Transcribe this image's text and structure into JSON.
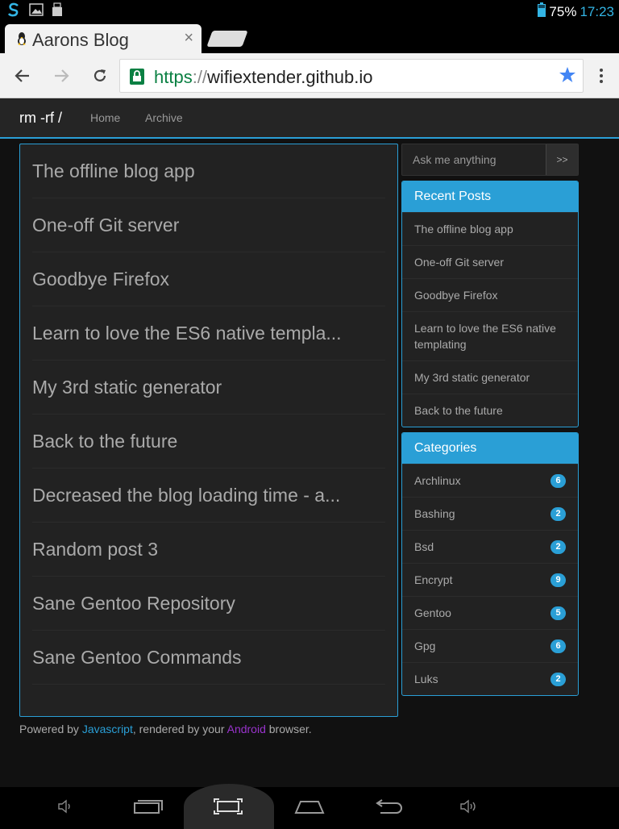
{
  "status": {
    "battery": "75%",
    "time": "17:23"
  },
  "tab": {
    "title": "Aarons Blog",
    "close": "×"
  },
  "address": {
    "scheme": "https",
    "sep": "://",
    "host": "wifiextender.github.io"
  },
  "nav": {
    "brand": "rm -rf /",
    "links": [
      "Home",
      "Archive"
    ]
  },
  "posts": [
    "The offline blog app",
    "One-off Git server",
    "Goodbye Firefox",
    "Learn to love the ES6 native templa...",
    "My 3rd static generator",
    "Back to the future",
    "Decreased the blog loading time - a...",
    "Random post 3",
    "Sane Gentoo Repository",
    "Sane Gentoo Commands"
  ],
  "search": {
    "placeholder": "Ask me anything",
    "button": ">>"
  },
  "recent": {
    "title": "Recent Posts",
    "items": [
      "The offline blog app",
      "One-off Git server",
      "Goodbye Firefox",
      "Learn to love the ES6 native templating",
      "My 3rd static generator",
      "Back to the future"
    ]
  },
  "categories": {
    "title": "Categories",
    "items": [
      {
        "name": "Archlinux",
        "count": "6"
      },
      {
        "name": "Bashing",
        "count": "2"
      },
      {
        "name": "Bsd",
        "count": "2"
      },
      {
        "name": "Encrypt",
        "count": "9"
      },
      {
        "name": "Gentoo",
        "count": "5"
      },
      {
        "name": "Gpg",
        "count": "6"
      },
      {
        "name": "Luks",
        "count": "2"
      }
    ]
  },
  "footer": {
    "prefix": "Powered by ",
    "js": "Javascript",
    "middle": ", rendered by your ",
    "android": "Android",
    "suffix": " browser."
  },
  "colors": {
    "accent": "#2a9fd6",
    "android": "#9933cc",
    "secure": "#0b8043",
    "status": "#33b5e5"
  }
}
